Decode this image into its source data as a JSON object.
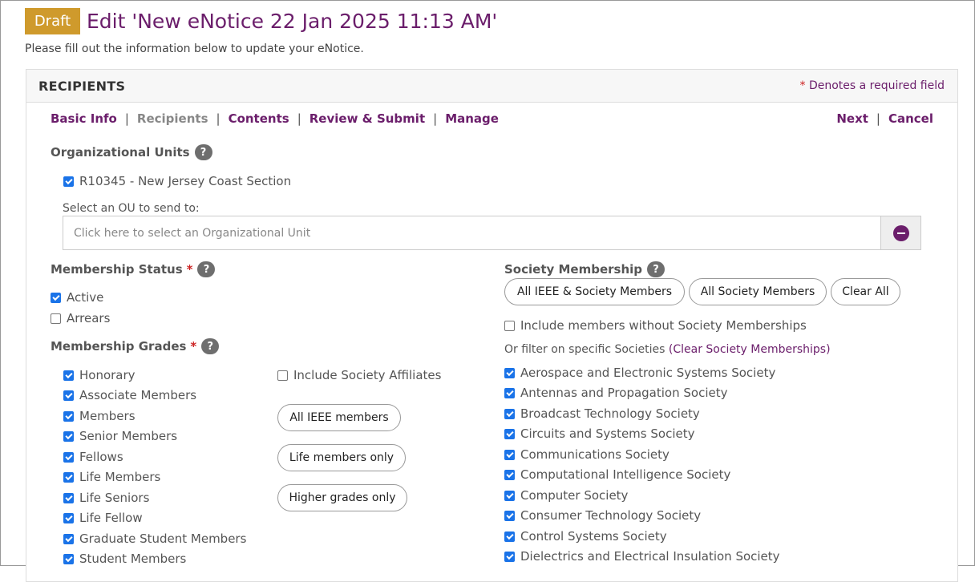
{
  "header": {
    "badge": "Draft",
    "title": "Edit 'New eNotice 22 Jan 2025 11:13 AM'",
    "subtitle": "Please fill out the information below to update your eNotice."
  },
  "panel": {
    "title": "RECIPIENTS",
    "required_star": "*",
    "required_note": "Denotes a required field"
  },
  "nav": {
    "steps": [
      {
        "label": "Basic Info",
        "current": false
      },
      {
        "label": "Recipients",
        "current": true
      },
      {
        "label": "Contents",
        "current": false
      },
      {
        "label": "Review & Submit",
        "current": false
      },
      {
        "label": "Manage",
        "current": false
      }
    ],
    "next": "Next",
    "cancel": "Cancel",
    "separator": "|"
  },
  "org_units": {
    "label": "Organizational Units",
    "help": "?",
    "selected": [
      {
        "label": "R10345 - New Jersey Coast Section",
        "checked": true
      }
    ],
    "select_label": "Select an OU to send to:",
    "placeholder": "Click here to select an Organizational Unit"
  },
  "membership_status": {
    "label": "Membership Status",
    "star": "*",
    "help": "?",
    "options": [
      {
        "label": "Active",
        "checked": true
      },
      {
        "label": "Arrears",
        "checked": false
      }
    ]
  },
  "membership_grades": {
    "label": "Membership Grades",
    "star": "*",
    "help": "?",
    "options": [
      {
        "label": "Honorary",
        "checked": true
      },
      {
        "label": "Associate Members",
        "checked": true
      },
      {
        "label": "Members",
        "checked": true
      },
      {
        "label": "Senior Members",
        "checked": true
      },
      {
        "label": "Fellows",
        "checked": true
      },
      {
        "label": "Life Members",
        "checked": true
      },
      {
        "label": "Life Seniors",
        "checked": true
      },
      {
        "label": "Life Fellow",
        "checked": true
      },
      {
        "label": "Graduate Student Members",
        "checked": true
      },
      {
        "label": "Student Members",
        "checked": true
      }
    ],
    "include_affiliates": {
      "label": "Include Society Affiliates",
      "checked": false
    },
    "buttons": [
      "All IEEE members",
      "Life members only",
      "Higher grades only"
    ]
  },
  "society": {
    "label": "Society Membership",
    "help": "?",
    "buttons": [
      "All IEEE & Society Members",
      "All Society Members",
      "Clear All"
    ],
    "include_without": {
      "label": "Include members without Society Memberships",
      "checked": false
    },
    "filter_text": "Or filter on specific Societies",
    "filter_link": "(Clear Society Memberships)",
    "societies": [
      {
        "label": "Aerospace and Electronic Systems Society",
        "checked": true
      },
      {
        "label": "Antennas and Propagation Society",
        "checked": true
      },
      {
        "label": "Broadcast Technology Society",
        "checked": true
      },
      {
        "label": "Circuits and Systems Society",
        "checked": true
      },
      {
        "label": "Communications Society",
        "checked": true
      },
      {
        "label": "Computational Intelligence Society",
        "checked": true
      },
      {
        "label": "Computer Society",
        "checked": true
      },
      {
        "label": "Consumer Technology Society",
        "checked": true
      },
      {
        "label": "Control Systems Society",
        "checked": true
      },
      {
        "label": "Dielectrics and Electrical Insulation Society",
        "checked": true
      }
    ]
  },
  "colors": {
    "accent": "#6b1e6b",
    "badge": "#cf9a2c",
    "checkbox": "#1a73e8",
    "required": "#cc2222"
  }
}
